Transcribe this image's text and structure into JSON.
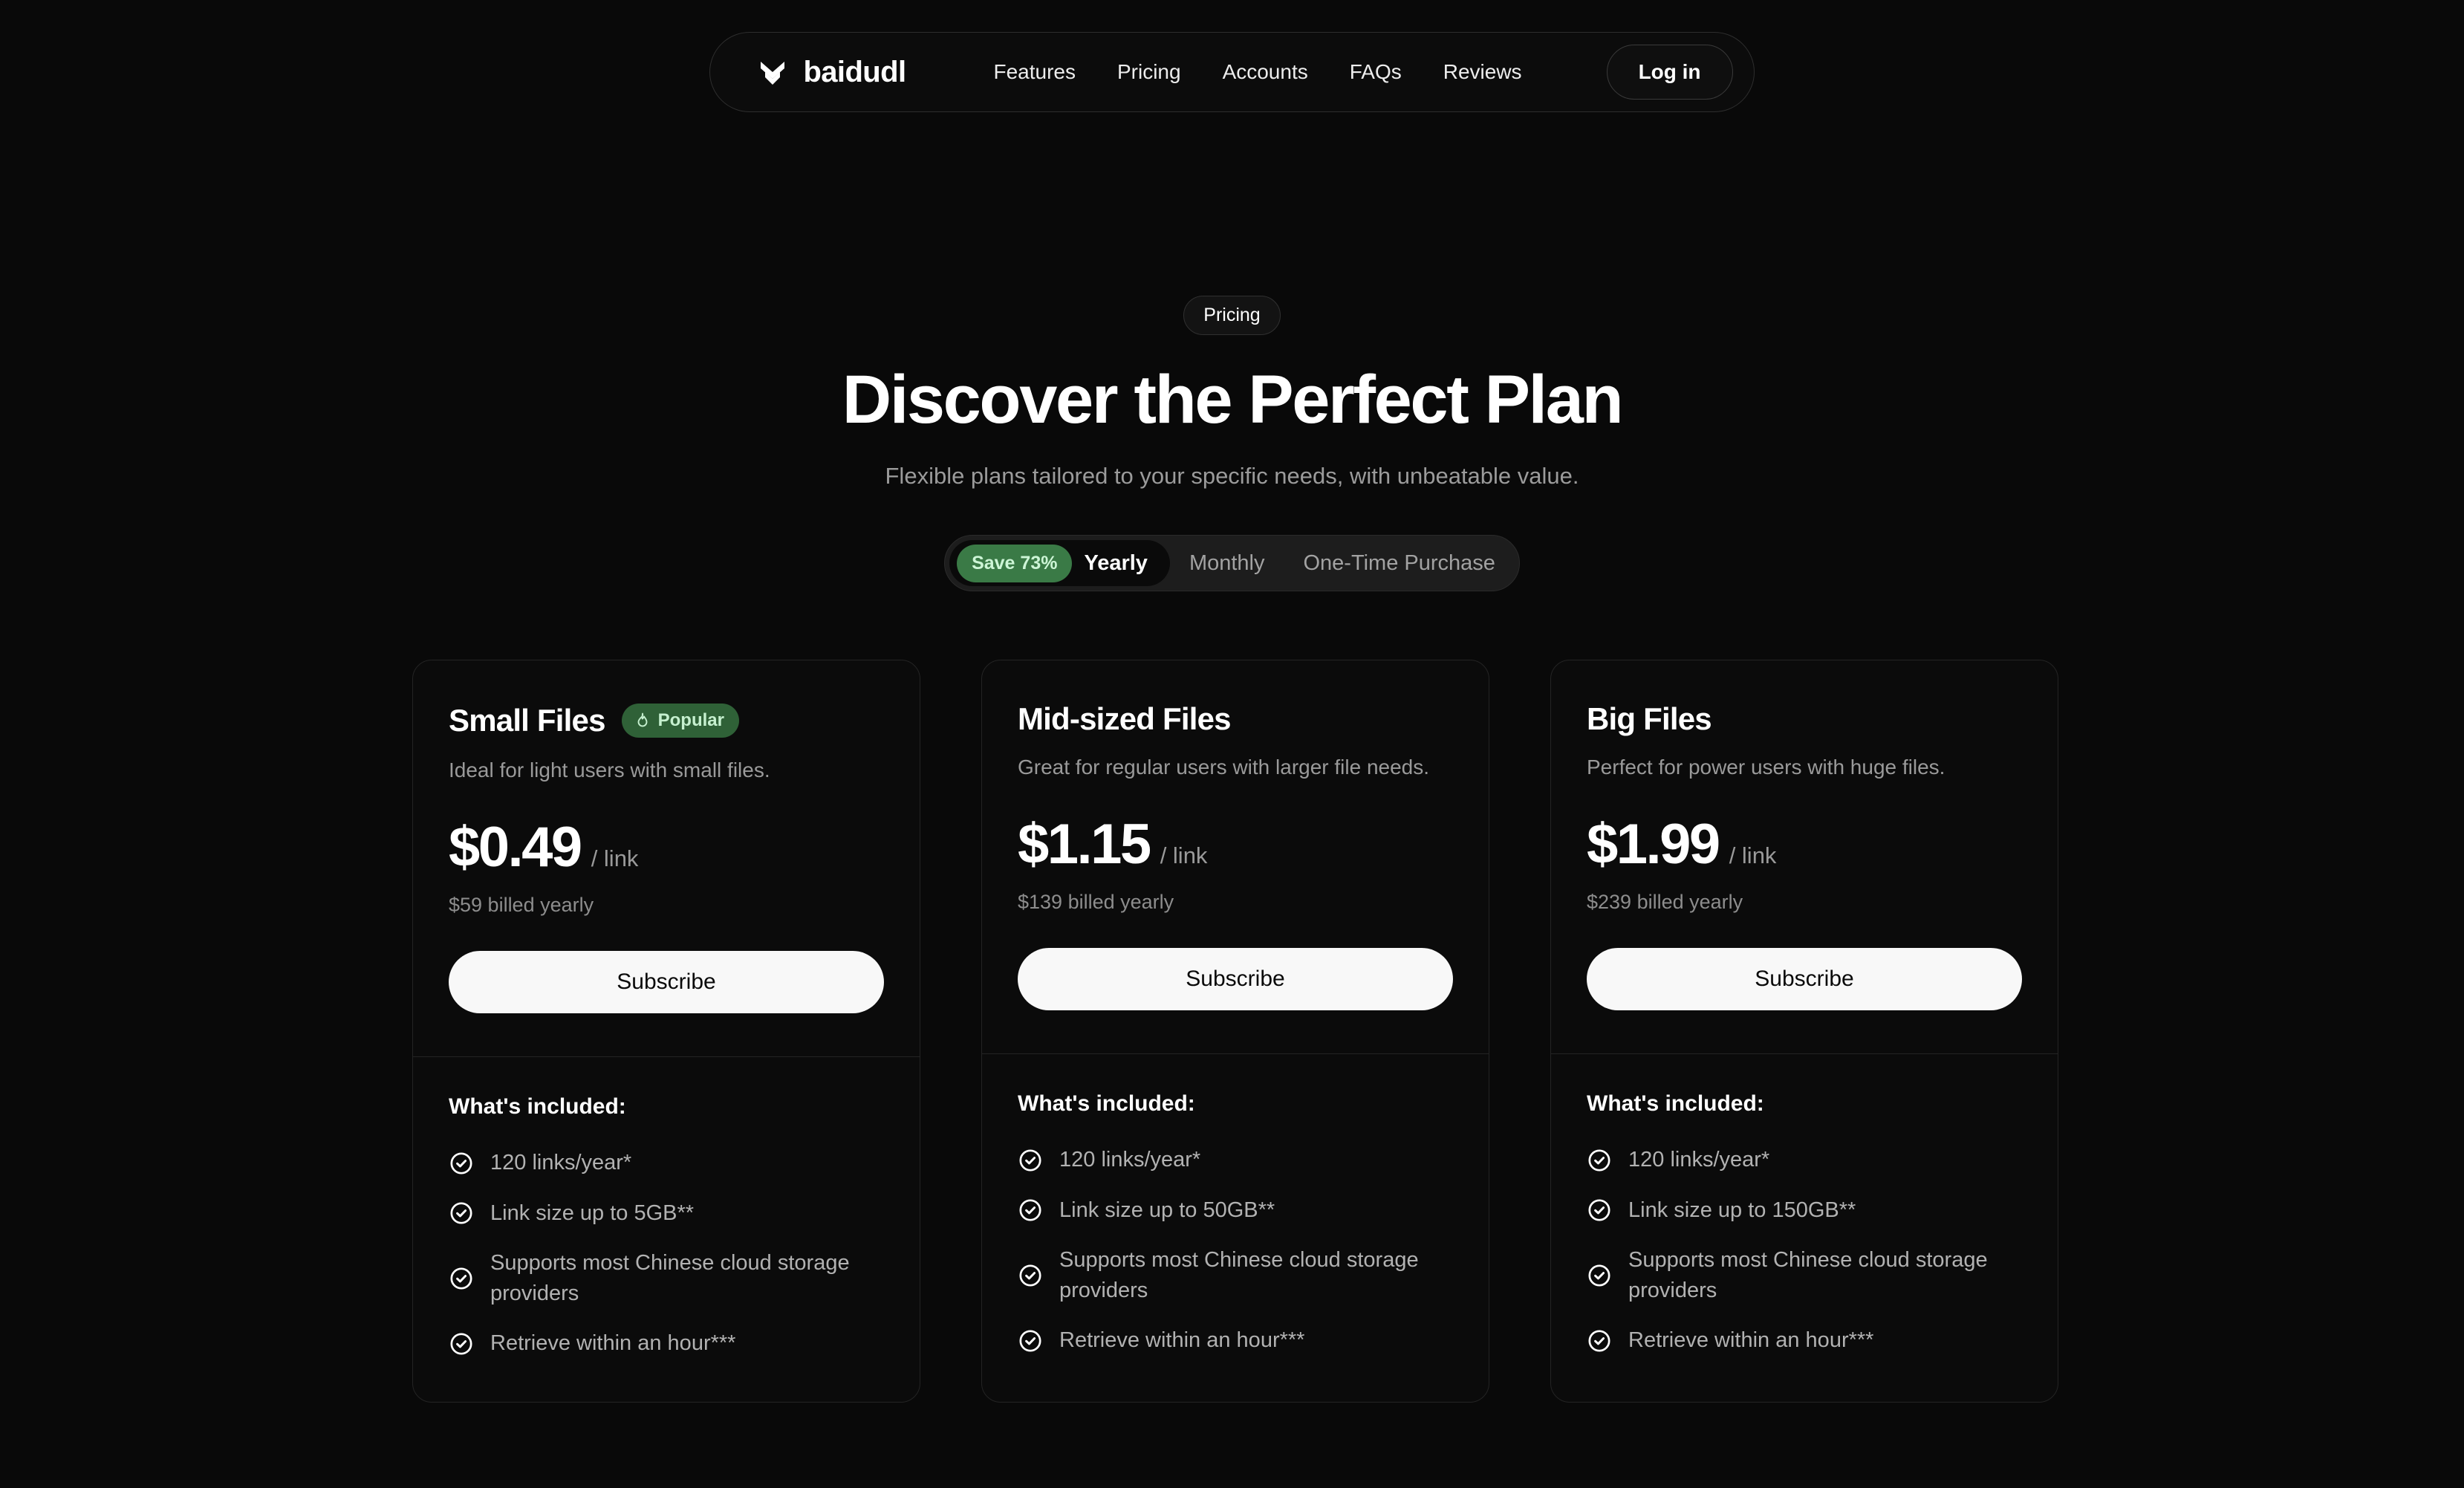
{
  "brand": {
    "name": "baidudl",
    "logo_icon": "double-chevron-down-icon"
  },
  "nav": {
    "links": [
      {
        "label": "Features"
      },
      {
        "label": "Pricing"
      },
      {
        "label": "Accounts"
      },
      {
        "label": "FAQs"
      },
      {
        "label": "Reviews"
      }
    ],
    "login_label": "Log in"
  },
  "hero": {
    "eyebrow": "Pricing",
    "title": "Discover the Perfect Plan",
    "subtitle": "Flexible plans tailored to your specific needs, with unbeatable value."
  },
  "billing_toggle": {
    "save_badge": "Save 73%",
    "options": [
      {
        "label": "Yearly",
        "active": true
      },
      {
        "label": "Monthly",
        "active": false
      },
      {
        "label": "One-Time Purchase",
        "active": false
      }
    ]
  },
  "included_label": "What's included:",
  "colors": {
    "page_bg": "#090909",
    "card_bg": "#0b0b0b",
    "card_border": "#242424",
    "accent_green": "#3a7a46",
    "badge_green_bg": "#2f6137",
    "badge_green_text": "#c6f0cf",
    "text_primary": "#ffffff",
    "text_muted": "#9a9a9a",
    "button_bg": "#f8f8f8"
  },
  "plans": [
    {
      "name": "Small Files",
      "badge": {
        "label": "Popular",
        "icon": "flame-icon"
      },
      "description": "Ideal for light users with small files.",
      "price": "$0.49",
      "price_unit": "/ link",
      "billed": "$59 billed yearly",
      "cta": "Subscribe",
      "features": [
        "120 links/year*",
        "Link size up to 5GB**",
        "Supports most Chinese cloud storage providers",
        "Retrieve within an hour***"
      ]
    },
    {
      "name": "Mid-sized Files",
      "badge": null,
      "description": "Great for regular users with larger file needs.",
      "price": "$1.15",
      "price_unit": "/ link",
      "billed": "$139 billed yearly",
      "cta": "Subscribe",
      "features": [
        "120 links/year*",
        "Link size up to 50GB**",
        "Supports most Chinese cloud storage providers",
        "Retrieve within an hour***"
      ]
    },
    {
      "name": "Big Files",
      "badge": null,
      "description": "Perfect for power users with huge files.",
      "price": "$1.99",
      "price_unit": "/ link",
      "billed": "$239 billed yearly",
      "cta": "Subscribe",
      "features": [
        "120 links/year*",
        "Link size up to 150GB**",
        "Supports most Chinese cloud storage providers",
        "Retrieve within an hour***"
      ]
    }
  ]
}
